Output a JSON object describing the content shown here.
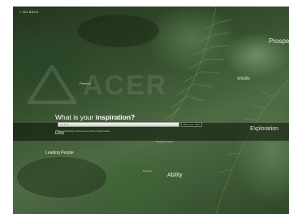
{
  "nav": {
    "back_label": "< GO BACK"
  },
  "watermark": {
    "word": "ACER"
  },
  "prompt": {
    "question_lead": "What is your ",
    "question_emph": "inspiration?"
  },
  "search": {
    "value": "Art & Co",
    "placeholder": "",
    "submit_label": "Write your Idea!",
    "hint": "Type anything or choose one of the topics below."
  },
  "topics": {
    "prosper": "Prosper",
    "wildlife": "Wildlife",
    "penemi": "Penemi",
    "exploration": "Exploration",
    "dou": "Dou",
    "leading_people": "Leading People",
    "ability": "Ability",
    "small_a": "Design Process",
    "small_b": "Discover"
  },
  "colors": {
    "foliage_dark": "#24361f",
    "foliage_mid": "#4f6c45",
    "band": "#0a1008"
  }
}
